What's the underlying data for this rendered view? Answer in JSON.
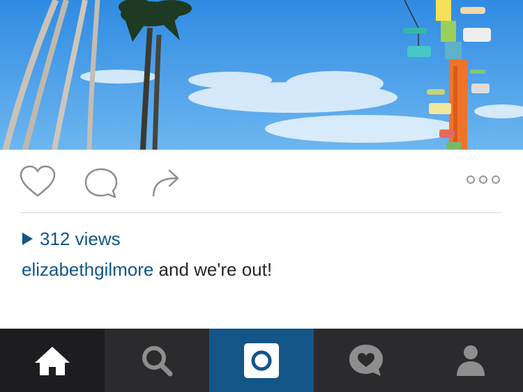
{
  "post": {
    "photo": {
      "sky_top": "#2f8be2",
      "sky_bottom": "#6db6f0"
    },
    "actions": {
      "like_icon": "heart-icon",
      "comment_icon": "speech-bubble-icon",
      "share_icon": "share-arrow-icon",
      "more_icon": "three-dots-icon"
    },
    "views_label": "312 views",
    "caption": {
      "username": "elizabethgilmore",
      "text": " and we're out!"
    }
  },
  "tabbar": {
    "tabs": [
      {
        "name": "home",
        "icon": "home-icon",
        "active": true
      },
      {
        "name": "search",
        "icon": "search-icon",
        "active": false
      },
      {
        "name": "camera",
        "icon": "camera-icon",
        "active": false
      },
      {
        "name": "activity",
        "icon": "activity-heart-icon",
        "active": false
      },
      {
        "name": "profile",
        "icon": "profile-icon",
        "active": false
      }
    ]
  },
  "colors": {
    "link_blue": "#125688",
    "tab_bar": "#2b2b2d",
    "tab_active": "#1d1d1f",
    "camera_tab": "#125688",
    "icon_gray": "#888888"
  }
}
